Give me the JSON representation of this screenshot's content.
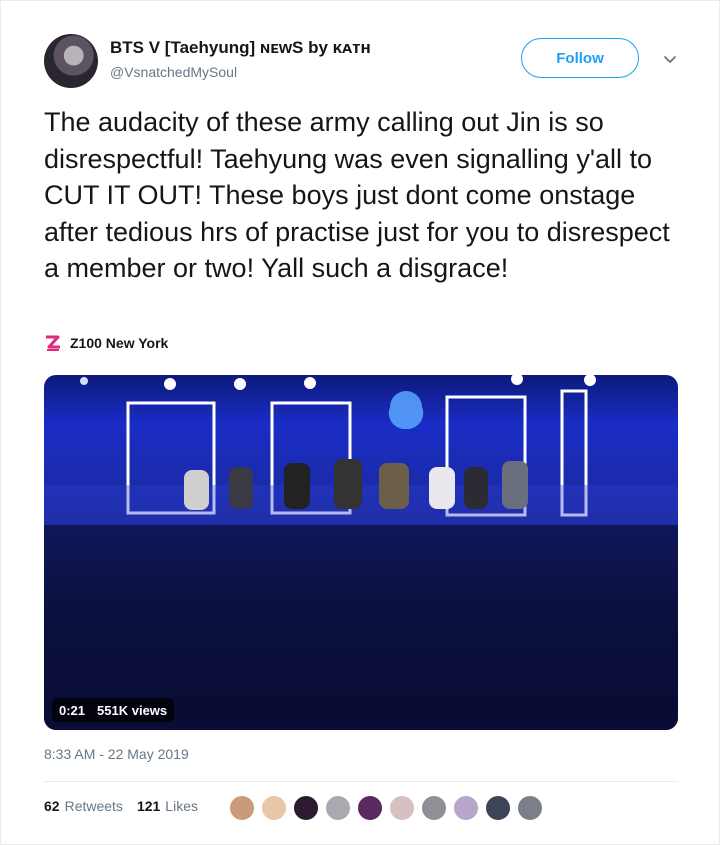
{
  "tweet": {
    "author_name": "BTS V [Taehyung] ɴᴇᴡS by ᴋᴀᴛʜ",
    "author_handle": "@VsnatchedMySoul",
    "follow_label": "Follow",
    "text": "The audacity of these army calling out Jin is so disrespectful! Taehyung was even signalling y'all to CUT IT OUT! These boys just dont come onstage after tedious hrs of practise just for you to disrespect a member or two! Yall such a disgrace!",
    "source_name": "Z100 New York",
    "video": {
      "duration": "0:21",
      "views": "551K views"
    },
    "timestamp": "8:33 AM - 22 May 2019",
    "retweets_count": "62",
    "retweets_label": "Retweets",
    "likes_count": "121",
    "likes_label": "Likes"
  },
  "icons": [
    "avatar-image",
    "z100-logo-icon",
    "chevron-down-icon"
  ],
  "colors": {
    "accent": "#1da1f2",
    "text": "#14171a",
    "muted": "#657786"
  }
}
